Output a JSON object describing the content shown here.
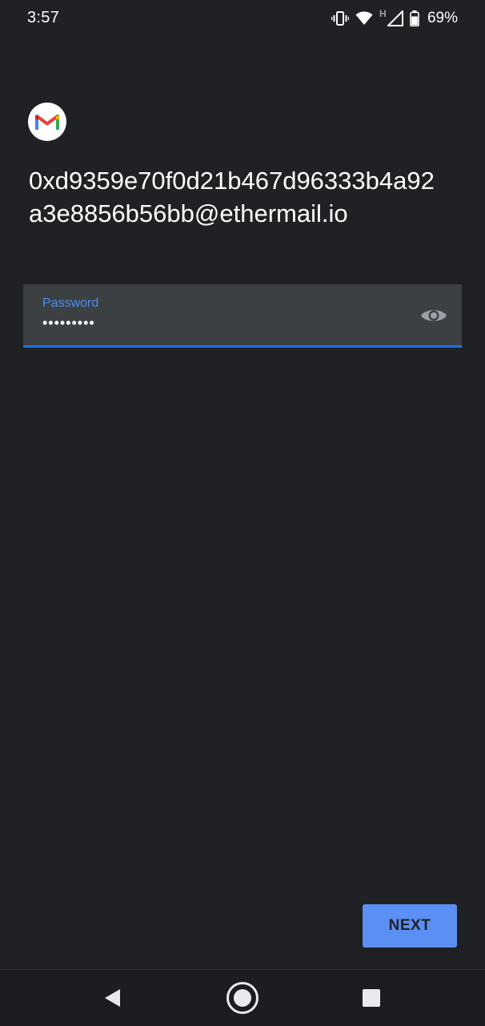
{
  "status_bar": {
    "time": "3:57",
    "battery_percent": "69%",
    "network_type": "H",
    "icons": [
      "vibrate-icon",
      "wifi-icon",
      "signal-icon",
      "battery-icon"
    ]
  },
  "app": {
    "logo_icon": "gmail-logo-icon"
  },
  "account": {
    "email": "0xd9359e70f0d21b467d96333b4a92a3e8856b56bb@ethermail.io"
  },
  "password_field": {
    "label": "Password",
    "value_masked": "•••••••••",
    "toggle_icon": "eye-icon",
    "accent_color": "#1a73e8"
  },
  "actions": {
    "next_label": "NEXT",
    "next_color": "#5b8ff3"
  },
  "nav_bar": {
    "back_icon": "back-icon",
    "home_icon": "home-icon",
    "recents_icon": "recents-icon"
  },
  "colors": {
    "background": "#202124",
    "field_background": "#3c4043",
    "label_color": "#4b8ef0"
  }
}
